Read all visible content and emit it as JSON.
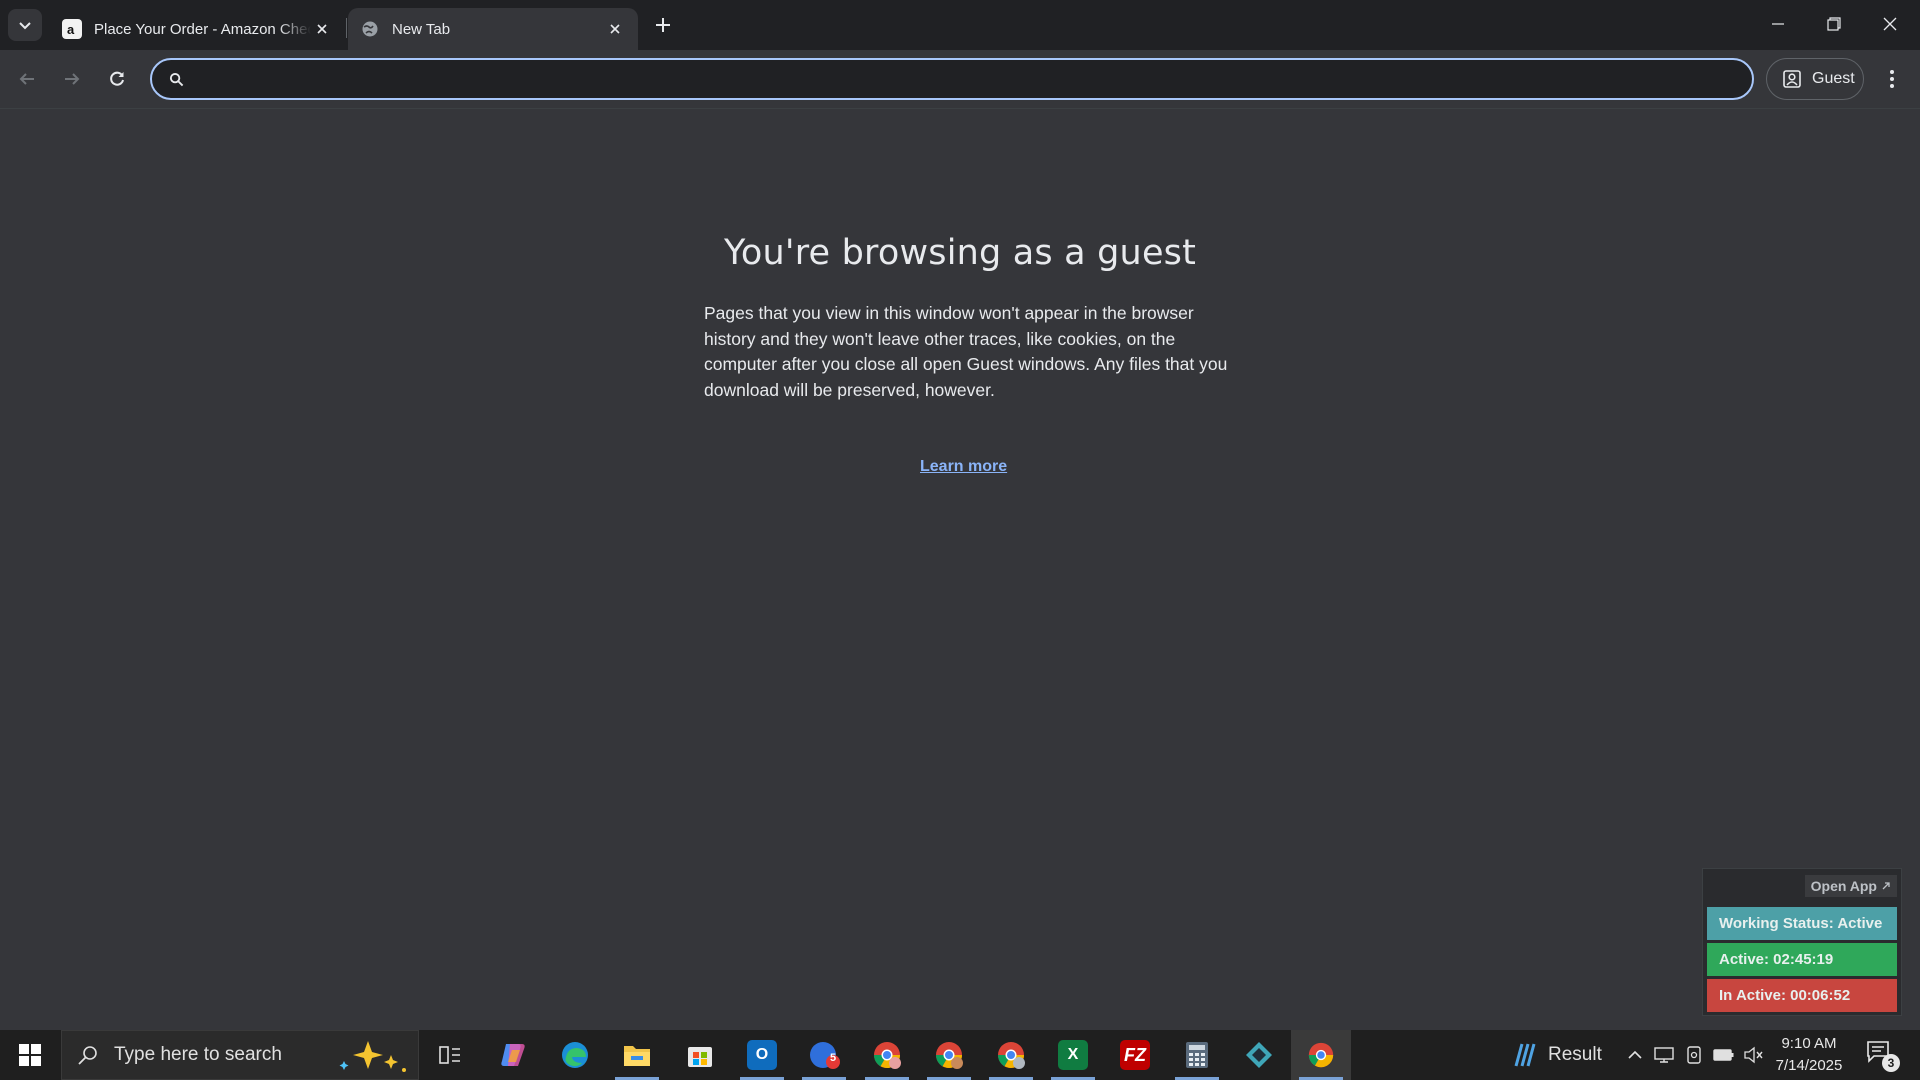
{
  "browser": {
    "tabs": [
      {
        "title": "Place Your Order - Amazon Checkout",
        "favicon": "amazon-icon",
        "active": false
      },
      {
        "title": "New Tab",
        "favicon": "globe-icon",
        "active": true
      }
    ],
    "omnibox": {
      "value": "",
      "placeholder": ""
    },
    "profile_label": "Guest"
  },
  "page": {
    "heading": "You're browsing as a guest",
    "description": "Pages that you view in this window won't appear in the browser history and they won't leave other traces, like cookies, on the computer after you close all open Guest windows. Any files that you download will be preserved, however.",
    "learn_more": "Learn more"
  },
  "status_widget": {
    "open_app": "Open App",
    "working_status": "Working Status: Active",
    "active_time": "Active: 02:45:19",
    "inactive_time": "In Active: 00:06:52",
    "colors": {
      "status": "#4da0a7",
      "active": "#2fa85a",
      "inactive": "#c8463f"
    }
  },
  "taskbar": {
    "search_placeholder": "Type here to search",
    "weather_label": "Result",
    "time": "9:10 AM",
    "date": "7/14/2025",
    "notification_count": "3",
    "calendar_badge": "5",
    "apps": [
      "task-view-icon",
      "copilot-icon",
      "edge-icon",
      "file-explorer-icon",
      "store-icon",
      "outlook-icon",
      "calendar-app-icon",
      "chrome-profile-1-icon",
      "chrome-profile-2-icon",
      "chrome-profile-3-icon",
      "excel-icon",
      "filezilla-icon",
      "calculator-icon",
      "app-diamond-icon",
      "chrome-icon"
    ]
  }
}
